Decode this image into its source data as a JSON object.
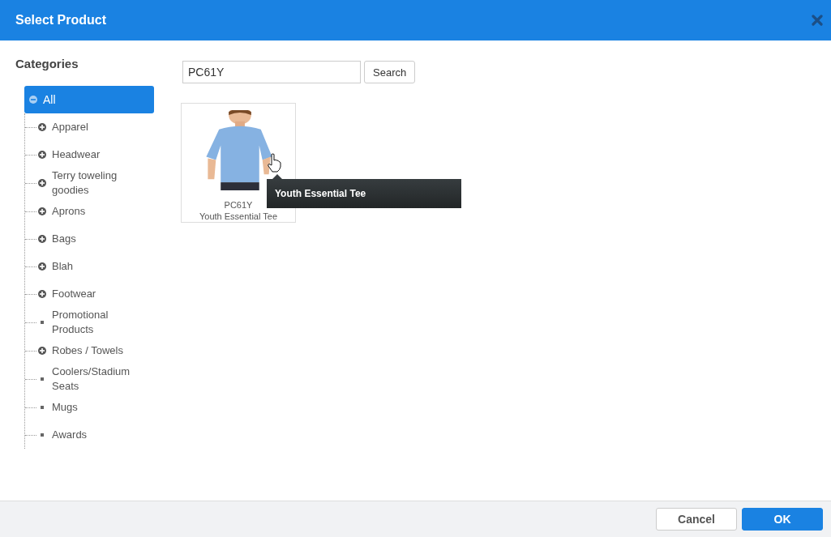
{
  "window": {
    "title": "Select Product"
  },
  "sidebar": {
    "heading": "Categories",
    "tree": [
      {
        "label": "All",
        "kind": "folder",
        "expanded": true,
        "selected": true,
        "children": [
          {
            "label": "Apparel",
            "kind": "folder",
            "expanded": false,
            "selected": false
          },
          {
            "label": "Headwear",
            "kind": "folder",
            "expanded": false,
            "selected": false
          },
          {
            "label": "Terry toweling goodies",
            "kind": "folder",
            "expanded": false,
            "selected": false
          },
          {
            "label": "Aprons",
            "kind": "folder",
            "expanded": false,
            "selected": false
          },
          {
            "label": "Bags",
            "kind": "folder",
            "expanded": false,
            "selected": false
          },
          {
            "label": "Blah",
            "kind": "folder",
            "expanded": false,
            "selected": false
          },
          {
            "label": "Footwear",
            "kind": "folder",
            "expanded": false,
            "selected": false
          },
          {
            "label": "Promotional Products",
            "kind": "leaf",
            "selected": false
          },
          {
            "label": "Robes / Towels",
            "kind": "folder",
            "expanded": false,
            "selected": false
          },
          {
            "label": "Coolers/Stadium Seats",
            "kind": "leaf",
            "selected": false
          },
          {
            "label": "Mugs",
            "kind": "leaf",
            "selected": false
          },
          {
            "label": "Awards",
            "kind": "leaf",
            "selected": false
          }
        ]
      }
    ]
  },
  "search": {
    "value": "PC61Y",
    "button": "Search"
  },
  "products": [
    {
      "code": "PC61Y",
      "name": "Youth Essential Tee",
      "tooltip": "Youth Essential Tee"
    }
  ],
  "buttons": [
    {
      "label": "Cancel",
      "kind": "secondary"
    },
    {
      "label": "OK",
      "kind": "primary"
    }
  ]
}
